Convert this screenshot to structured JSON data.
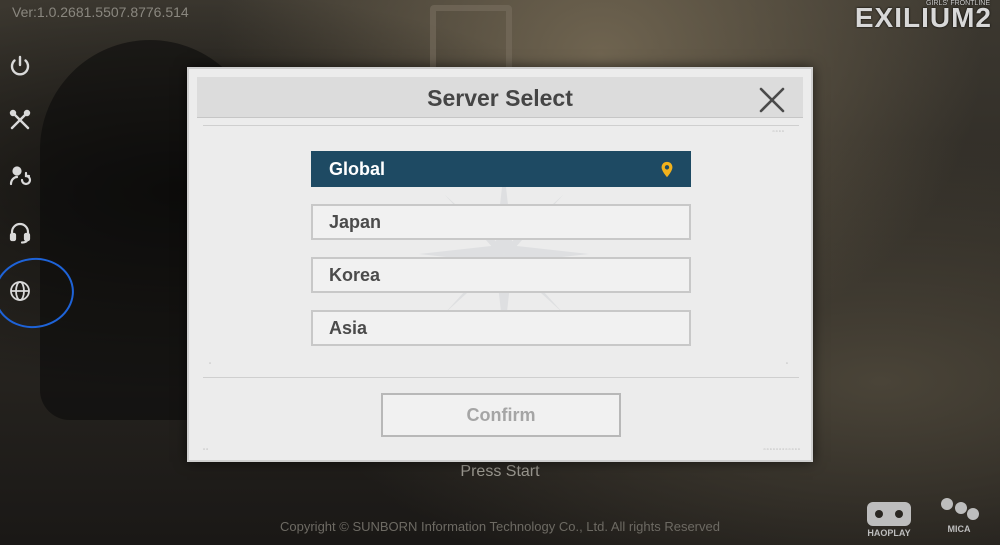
{
  "app": {
    "version": "Ver:1.0.2681.5507.8776.514",
    "brand": "EXILIUM2",
    "brand_sub": "GIRLS' FRONTLINE"
  },
  "sidebar": {
    "items": [
      {
        "icon": "power-icon"
      },
      {
        "icon": "tools-icon"
      },
      {
        "icon": "account-switch-icon"
      },
      {
        "icon": "headset-icon"
      },
      {
        "icon": "globe-icon"
      }
    ]
  },
  "dialog": {
    "title": "Server Select",
    "servers": [
      {
        "label": "Global",
        "selected": true
      },
      {
        "label": "Japan",
        "selected": false
      },
      {
        "label": "Korea",
        "selected": false
      },
      {
        "label": "Asia",
        "selected": false
      }
    ],
    "confirm_label": "Confirm",
    "accent_color": "#1e4a63",
    "pin_color": "#f2b21c"
  },
  "footer": {
    "press_start": "Press Start",
    "copyright": "Copyright © SUNBORN Information Technology Co., Ltd. All rights Reserved",
    "logo_left": "HAOPLAY",
    "logo_right": "MICA"
  }
}
